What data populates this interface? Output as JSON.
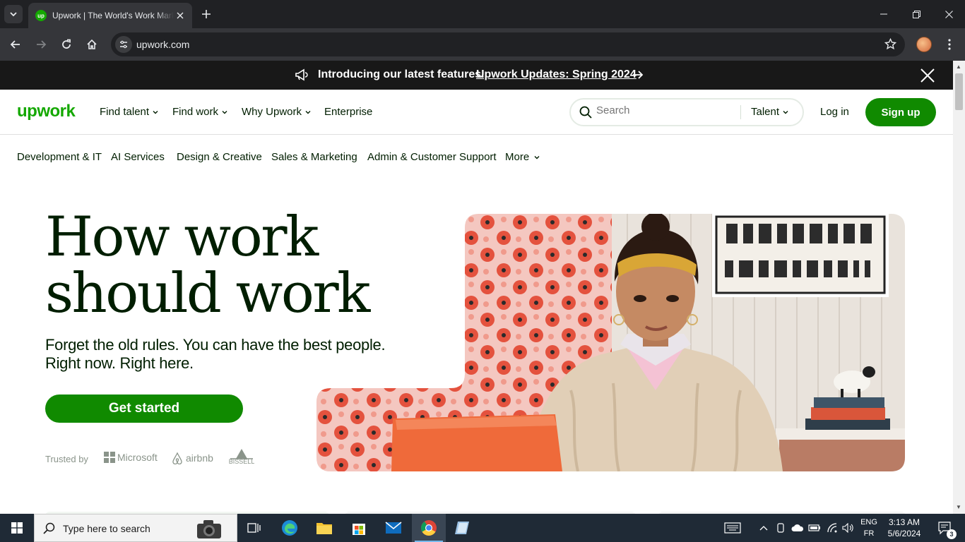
{
  "browser": {
    "tab_title": "Upwork | The World's Work Marketplace",
    "favicon_text": "up",
    "url": "upwork.com"
  },
  "banner": {
    "text": "Introducing our latest features.",
    "link": "Upwork Updates: Spring 2024"
  },
  "header": {
    "logo": "upwork",
    "nav": [
      "Find talent",
      "Find work",
      "Why Upwork",
      "Enterprise"
    ],
    "search_placeholder": "Search",
    "search_scope": "Talent",
    "login": "Log in",
    "signup": "Sign up"
  },
  "categories": [
    "Development & IT",
    "AI Services",
    "Design & Creative",
    "Sales & Marketing",
    "Admin & Customer Support",
    "More"
  ],
  "hero": {
    "title_line1": "How work",
    "title_line2": "should work",
    "subtitle_line1": "Forget the old rules. You can have the best people.",
    "subtitle_line2": "Right now. Right here.",
    "cta": "Get started",
    "trusted_by": "Trusted by",
    "brands": [
      "Microsoft",
      "airbnb",
      "BISSELL"
    ]
  },
  "taskbar": {
    "search_placeholder": "Type here to search",
    "lang_line1": "ENG",
    "lang_line2": "FR",
    "time": "3:13 AM",
    "date": "5/6/2024",
    "notifications": "3"
  },
  "colors": {
    "brand_green": "#14a800",
    "button_green": "#108a00",
    "banner_bg": "#181818",
    "text_dark": "#001e00"
  }
}
